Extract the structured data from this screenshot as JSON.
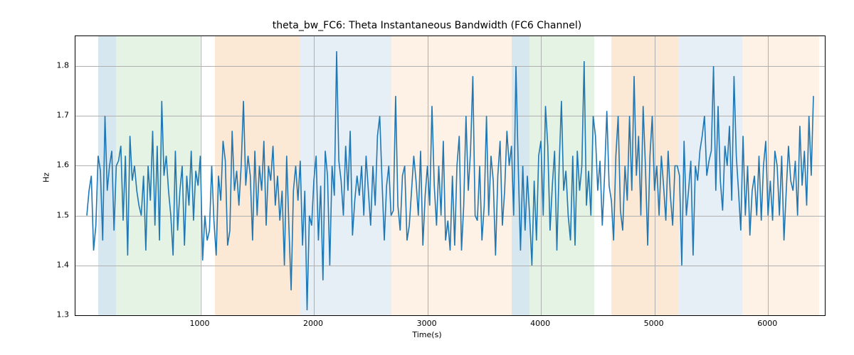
{
  "chart_data": {
    "type": "line",
    "title": "theta_bw_FC6: Theta Instantaneous Bandwidth (FC6 Channel)",
    "xlabel": "Time(s)",
    "ylabel": "Hz",
    "xlim": [
      -100,
      6500
    ],
    "ylim": [
      1.3,
      1.86
    ],
    "xticks": [
      1000,
      2000,
      3000,
      4000,
      5000,
      6000
    ],
    "yticks": [
      1.3,
      1.4,
      1.5,
      1.6,
      1.7,
      1.8
    ],
    "line_color": "#1f77b4",
    "bands": [
      {
        "x0": 100,
        "x1": 260,
        "color": "#6fa8c7"
      },
      {
        "x0": 260,
        "x1": 1000,
        "color": "#9fd49f"
      },
      {
        "x0": 1130,
        "x1": 1880,
        "color": "#f2b06a"
      },
      {
        "x0": 1880,
        "x1": 2680,
        "color": "#a8c4e0"
      },
      {
        "x0": 2680,
        "x1": 3740,
        "color": "#f7d1a3"
      },
      {
        "x0": 3740,
        "x1": 3900,
        "color": "#6fa8c7"
      },
      {
        "x0": 3900,
        "x1": 4470,
        "color": "#9fd49f"
      },
      {
        "x0": 4620,
        "x1": 5210,
        "color": "#f2b06a"
      },
      {
        "x0": 5210,
        "x1": 5770,
        "color": "#a8c4e0"
      },
      {
        "x0": 5770,
        "x1": 6450,
        "color": "#f7d1a3"
      }
    ],
    "x": [
      0,
      20,
      40,
      60,
      80,
      100,
      120,
      140,
      160,
      180,
      200,
      220,
      240,
      260,
      280,
      300,
      320,
      340,
      360,
      380,
      400,
      420,
      440,
      460,
      480,
      500,
      520,
      540,
      560,
      580,
      600,
      620,
      640,
      660,
      680,
      700,
      720,
      740,
      760,
      780,
      800,
      820,
      840,
      860,
      880,
      900,
      920,
      940,
      960,
      980,
      1000,
      1020,
      1040,
      1060,
      1080,
      1100,
      1120,
      1140,
      1160,
      1180,
      1200,
      1220,
      1240,
      1260,
      1280,
      1300,
      1320,
      1340,
      1360,
      1380,
      1400,
      1420,
      1440,
      1460,
      1480,
      1500,
      1520,
      1540,
      1560,
      1580,
      1600,
      1620,
      1640,
      1660,
      1680,
      1700,
      1720,
      1740,
      1760,
      1780,
      1800,
      1820,
      1840,
      1860,
      1880,
      1900,
      1920,
      1940,
      1960,
      1980,
      2000,
      2020,
      2040,
      2060,
      2080,
      2100,
      2120,
      2140,
      2160,
      2180,
      2200,
      2220,
      2240,
      2260,
      2280,
      2300,
      2320,
      2340,
      2360,
      2380,
      2400,
      2420,
      2440,
      2460,
      2480,
      2500,
      2520,
      2540,
      2560,
      2580,
      2600,
      2620,
      2640,
      2660,
      2680,
      2700,
      2720,
      2740,
      2760,
      2780,
      2800,
      2820,
      2840,
      2860,
      2880,
      2900,
      2920,
      2940,
      2960,
      2980,
      3000,
      3020,
      3040,
      3060,
      3080,
      3100,
      3120,
      3140,
      3160,
      3180,
      3200,
      3220,
      3240,
      3260,
      3280,
      3300,
      3320,
      3340,
      3360,
      3380,
      3400,
      3420,
      3440,
      3460,
      3480,
      3500,
      3520,
      3540,
      3560,
      3580,
      3600,
      3620,
      3640,
      3660,
      3680,
      3700,
      3720,
      3740,
      3760,
      3780,
      3800,
      3820,
      3840,
      3860,
      3880,
      3900,
      3920,
      3940,
      3960,
      3980,
      4000,
      4020,
      4040,
      4060,
      4080,
      4100,
      4120,
      4140,
      4160,
      4180,
      4200,
      4220,
      4240,
      4260,
      4280,
      4300,
      4320,
      4340,
      4360,
      4380,
      4400,
      4420,
      4440,
      4460,
      4480,
      4500,
      4520,
      4540,
      4560,
      4580,
      4600,
      4620,
      4640,
      4660,
      4680,
      4700,
      4720,
      4740,
      4760,
      4780,
      4800,
      4820,
      4840,
      4860,
      4880,
      4900,
      4920,
      4940,
      4960,
      4980,
      5000,
      5020,
      5040,
      5060,
      5080,
      5100,
      5120,
      5140,
      5160,
      5180,
      5200,
      5220,
      5240,
      5260,
      5280,
      5300,
      5320,
      5340,
      5360,
      5380,
      5400,
      5420,
      5440,
      5460,
      5480,
      5500,
      5520,
      5540,
      5560,
      5580,
      5600,
      5620,
      5640,
      5660,
      5680,
      5700,
      5720,
      5740,
      5760,
      5780,
      5800,
      5820,
      5840,
      5860,
      5880,
      5900,
      5920,
      5940,
      5960,
      5980,
      6000,
      6020,
      6040,
      6060,
      6080,
      6100,
      6120,
      6140,
      6160,
      6180,
      6200,
      6220,
      6240,
      6260,
      6280,
      6300,
      6320,
      6340,
      6360,
      6380,
      6400
    ],
    "y": [
      1.5,
      1.55,
      1.58,
      1.43,
      1.48,
      1.62,
      1.59,
      1.45,
      1.7,
      1.55,
      1.6,
      1.63,
      1.47,
      1.6,
      1.61,
      1.64,
      1.49,
      1.62,
      1.42,
      1.66,
      1.57,
      1.6,
      1.55,
      1.52,
      1.5,
      1.58,
      1.43,
      1.6,
      1.53,
      1.67,
      1.48,
      1.64,
      1.45,
      1.73,
      1.58,
      1.62,
      1.55,
      1.5,
      1.42,
      1.63,
      1.47,
      1.55,
      1.6,
      1.44,
      1.58,
      1.52,
      1.63,
      1.49,
      1.59,
      1.56,
      1.62,
      1.41,
      1.5,
      1.45,
      1.47,
      1.6,
      1.49,
      1.42,
      1.58,
      1.53,
      1.65,
      1.61,
      1.44,
      1.47,
      1.67,
      1.55,
      1.59,
      1.52,
      1.6,
      1.73,
      1.56,
      1.62,
      1.58,
      1.45,
      1.63,
      1.5,
      1.6,
      1.55,
      1.65,
      1.48,
      1.6,
      1.57,
      1.64,
      1.52,
      1.58,
      1.49,
      1.55,
      1.4,
      1.62,
      1.48,
      1.35,
      1.55,
      1.6,
      1.53,
      1.61,
      1.44,
      1.55,
      1.31,
      1.5,
      1.48,
      1.57,
      1.62,
      1.45,
      1.56,
      1.37,
      1.63,
      1.58,
      1.4,
      1.6,
      1.54,
      1.83,
      1.61,
      1.57,
      1.5,
      1.64,
      1.55,
      1.67,
      1.46,
      1.53,
      1.58,
      1.54,
      1.6,
      1.5,
      1.62,
      1.55,
      1.48,
      1.6,
      1.52,
      1.66,
      1.7,
      1.57,
      1.45,
      1.56,
      1.6,
      1.5,
      1.51,
      1.74,
      1.52,
      1.47,
      1.58,
      1.6,
      1.45,
      1.48,
      1.55,
      1.62,
      1.57,
      1.5,
      1.63,
      1.44,
      1.54,
      1.6,
      1.52,
      1.72,
      1.56,
      1.48,
      1.6,
      1.5,
      1.65,
      1.45,
      1.49,
      1.43,
      1.58,
      1.44,
      1.6,
      1.66,
      1.43,
      1.52,
      1.7,
      1.55,
      1.63,
      1.78,
      1.5,
      1.49,
      1.6,
      1.45,
      1.52,
      1.7,
      1.5,
      1.62,
      1.57,
      1.42,
      1.58,
      1.65,
      1.48,
      1.55,
      1.67,
      1.6,
      1.64,
      1.5,
      1.8,
      1.6,
      1.43,
      1.6,
      1.47,
      1.58,
      1.5,
      1.4,
      1.57,
      1.45,
      1.62,
      1.65,
      1.5,
      1.72,
      1.64,
      1.47,
      1.56,
      1.63,
      1.43,
      1.6,
      1.73,
      1.55,
      1.59,
      1.5,
      1.45,
      1.62,
      1.44,
      1.63,
      1.55,
      1.6,
      1.81,
      1.52,
      1.59,
      1.5,
      1.7,
      1.66,
      1.55,
      1.61,
      1.48,
      1.58,
      1.71,
      1.56,
      1.53,
      1.45,
      1.62,
      1.7,
      1.51,
      1.47,
      1.6,
      1.53,
      1.7,
      1.55,
      1.78,
      1.58,
      1.66,
      1.5,
      1.72,
      1.6,
      1.44,
      1.62,
      1.7,
      1.55,
      1.6,
      1.5,
      1.62,
      1.56,
      1.49,
      1.63,
      1.54,
      1.48,
      1.6,
      1.6,
      1.58,
      1.4,
      1.65,
      1.5,
      1.55,
      1.61,
      1.42,
      1.6,
      1.57,
      1.63,
      1.66,
      1.7,
      1.58,
      1.61,
      1.63,
      1.8,
      1.55,
      1.72,
      1.57,
      1.51,
      1.64,
      1.6,
      1.68,
      1.53,
      1.78,
      1.62,
      1.55,
      1.47,
      1.66,
      1.5,
      1.6,
      1.46,
      1.55,
      1.58,
      1.5,
      1.62,
      1.49,
      1.6,
      1.65,
      1.5,
      1.57,
      1.49,
      1.63,
      1.6,
      1.5,
      1.62,
      1.45,
      1.55,
      1.64,
      1.57,
      1.55,
      1.61,
      1.5,
      1.68,
      1.56,
      1.63,
      1.52,
      1.7,
      1.58,
      1.74
    ]
  }
}
